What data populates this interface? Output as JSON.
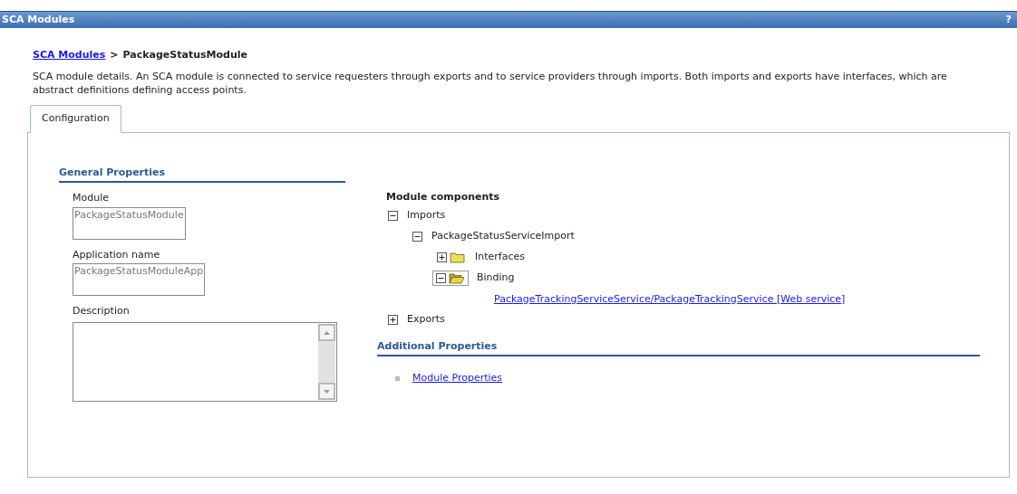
{
  "window": {
    "title": "SCA Modules",
    "help": "?"
  },
  "breadcrumb": {
    "link": "SCA Modules",
    "separator": ">",
    "current": "PackageStatusModule"
  },
  "description": "SCA module details. An SCA module is connected to service requesters through exports and to service providers through imports. Both imports and exports have interfaces, which are abstract definitions defining access points.",
  "tabs": [
    {
      "label": "Configuration",
      "selected": true
    }
  ],
  "general_properties": {
    "title": "General Properties",
    "fields": [
      {
        "label": "Module",
        "value": "PackageStatusModule",
        "kind": "text"
      },
      {
        "label": "Application name",
        "value": "PackageStatusModuleApp",
        "kind": "text"
      },
      {
        "label": "Description",
        "kind": "textarea"
      }
    ]
  },
  "module_components": {
    "title": "Module components",
    "tree": [
      {
        "label": "Imports",
        "kind": "node",
        "expanded": true,
        "selected": false,
        "children": [
          {
            "label": "PackageStatusServiceImport",
            "kind": "node",
            "expanded": true,
            "selected": false,
            "children": [
              {
                "label": "Interfaces",
                "kind": "folder",
                "expanded": false,
                "selected": false
              },
              {
                "label": "Binding",
                "kind": "folder",
                "expanded": true,
                "selected": true,
                "children": [
                  {
                    "label": "PackageTrackingServiceService/PackageTrackingService [Web service]",
                    "kind": "link"
                  }
                ]
              }
            ]
          }
        ]
      },
      {
        "label": "Exports",
        "kind": "node",
        "expanded": false,
        "selected": false
      }
    ]
  },
  "additional_properties": {
    "title": "Additional Properties",
    "links": [
      "Module Properties"
    ]
  }
}
